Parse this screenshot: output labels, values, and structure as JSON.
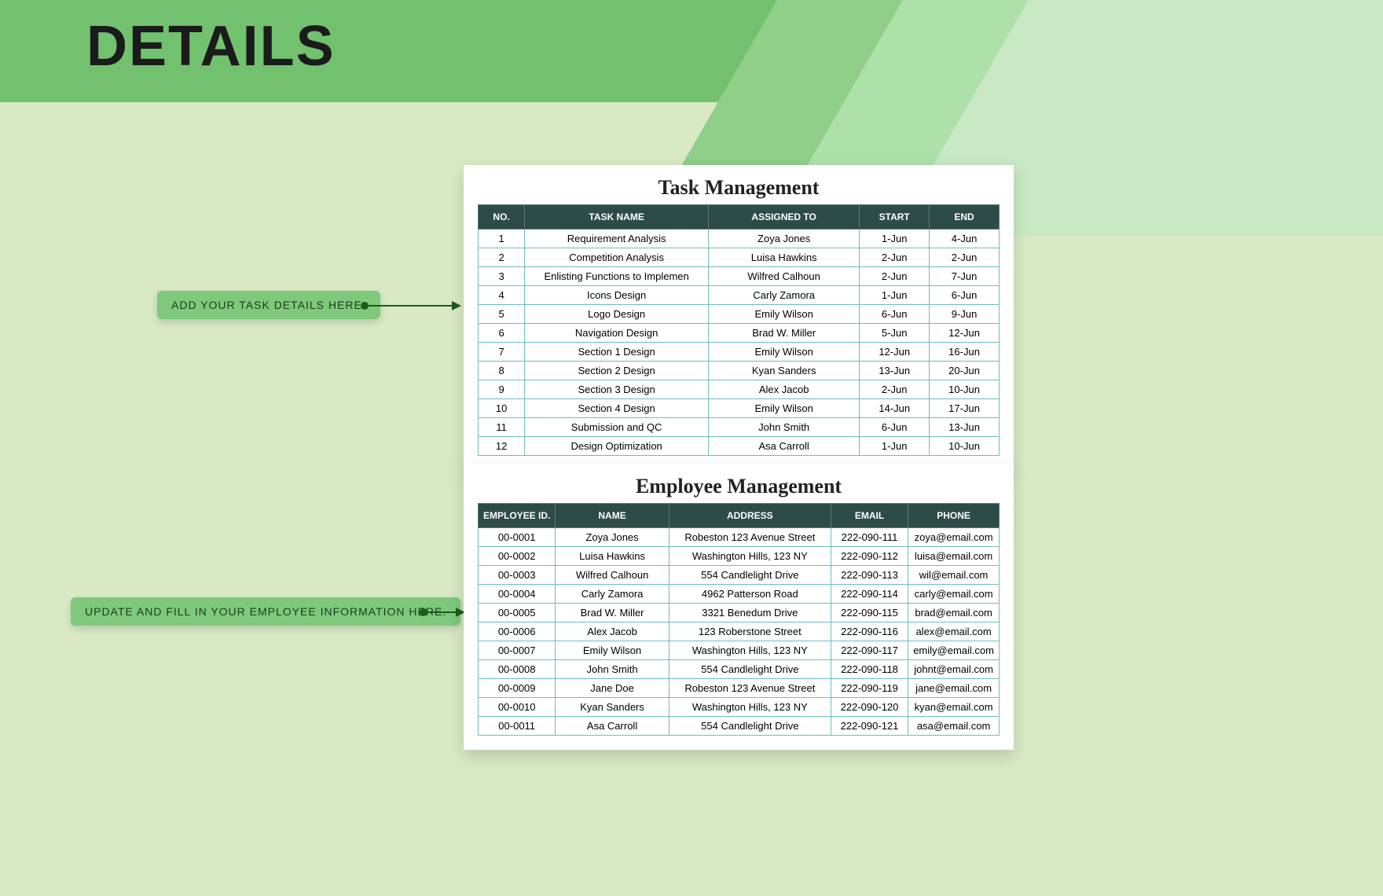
{
  "page": {
    "title": "DETAILS"
  },
  "callouts": {
    "task": "ADD YOUR TASK DETAILS HERE.",
    "employee": "UPDATE AND FILL IN YOUR EMPLOYEE INFORMATION HERE."
  },
  "task_mgmt": {
    "title": "Task Management",
    "headers": [
      "NO.",
      "TASK NAME",
      "ASSIGNED TO",
      "START",
      "END"
    ],
    "rows": [
      [
        "1",
        "Requirement Analysis",
        "Zoya Jones",
        "1-Jun",
        "4-Jun"
      ],
      [
        "2",
        "Competition Analysis",
        "Luisa Hawkins",
        "2-Jun",
        "2-Jun"
      ],
      [
        "3",
        "Enlisting Functions to Implemen",
        "Wilfred Calhoun",
        "2-Jun",
        "7-Jun"
      ],
      [
        "4",
        "Icons Design",
        "Carly Zamora",
        "1-Jun",
        "6-Jun"
      ],
      [
        "5",
        "Logo Design",
        "Emily Wilson",
        "6-Jun",
        "9-Jun"
      ],
      [
        "6",
        "Navigation Design",
        "Brad W. Miller",
        "5-Jun",
        "12-Jun"
      ],
      [
        "7",
        "Section 1 Design",
        "Emily Wilson",
        "12-Jun",
        "16-Jun"
      ],
      [
        "8",
        "Section 2 Design",
        "Kyan Sanders",
        "13-Jun",
        "20-Jun"
      ],
      [
        "9",
        "Section 3 Design",
        "Alex Jacob",
        "2-Jun",
        "10-Jun"
      ],
      [
        "10",
        "Section 4 Design",
        "Emily Wilson",
        "14-Jun",
        "17-Jun"
      ],
      [
        "11",
        "Submission and QC",
        "John Smith",
        "6-Jun",
        "13-Jun"
      ],
      [
        "12",
        "Design Optimization",
        "Asa Carroll",
        "1-Jun",
        "10-Jun"
      ]
    ]
  },
  "emp_mgmt": {
    "title": "Employee Management",
    "headers": [
      "EMPLOYEE ID.",
      "NAME",
      "ADDRESS",
      "EMAIL",
      "PHONE"
    ],
    "rows": [
      [
        "00-0001",
        "Zoya Jones",
        "Robeston 123 Avenue Street",
        "222-090-111",
        "zoya@email.com"
      ],
      [
        "00-0002",
        "Luisa Hawkins",
        "Washington Hills, 123 NY",
        "222-090-112",
        "luisa@email.com"
      ],
      [
        "00-0003",
        "Wilfred Calhoun",
        "554 Candlelight Drive",
        "222-090-113",
        "wil@email.com"
      ],
      [
        "00-0004",
        "Carly Zamora",
        "4962 Patterson Road",
        "222-090-114",
        "carly@email.com"
      ],
      [
        "00-0005",
        "Brad W. Miller",
        "3321 Benedum Drive",
        "222-090-115",
        "brad@email.com"
      ],
      [
        "00-0006",
        "Alex Jacob",
        "123 Roberstone Street",
        "222-090-116",
        "alex@email.com"
      ],
      [
        "00-0007",
        "Emily Wilson",
        "Washington Hills, 123 NY",
        "222-090-117",
        "emily@email.com"
      ],
      [
        "00-0008",
        "John Smith",
        "554 Candlelight Drive",
        "222-090-118",
        "johnt@email.com"
      ],
      [
        "00-0009",
        "Jane Doe",
        "Robeston 123 Avenue Street",
        "222-090-119",
        "jane@email.com"
      ],
      [
        "00-0010",
        "Kyan Sanders",
        "Washington Hills, 123 NY",
        "222-090-120",
        "kyan@email.com"
      ],
      [
        "00-0011",
        "Asa Carroll",
        "554 Candlelight Drive",
        "222-090-121",
        "asa@email.com"
      ]
    ]
  }
}
